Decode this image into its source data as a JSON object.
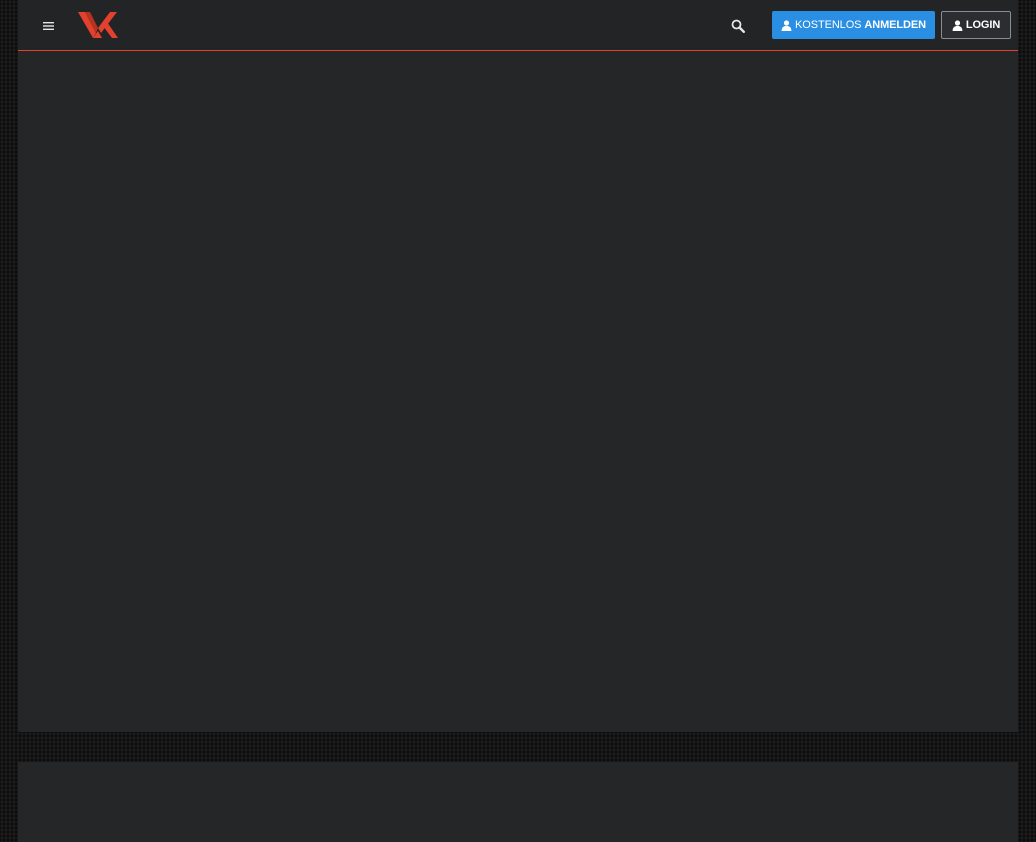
{
  "header": {
    "menu_icon": "hamburger-menu-icon",
    "logo_icon": "vx-logo-icon",
    "search_icon": "search-icon",
    "signup_button": {
      "icon": "user-icon",
      "label_light": "KOSTENLOS",
      "label_bold": "ANMELDEN"
    },
    "login_button": {
      "icon": "user-icon",
      "label": "LOGIN"
    },
    "accent_color": "#e2412d",
    "signup_color": "#2a8ee3"
  }
}
